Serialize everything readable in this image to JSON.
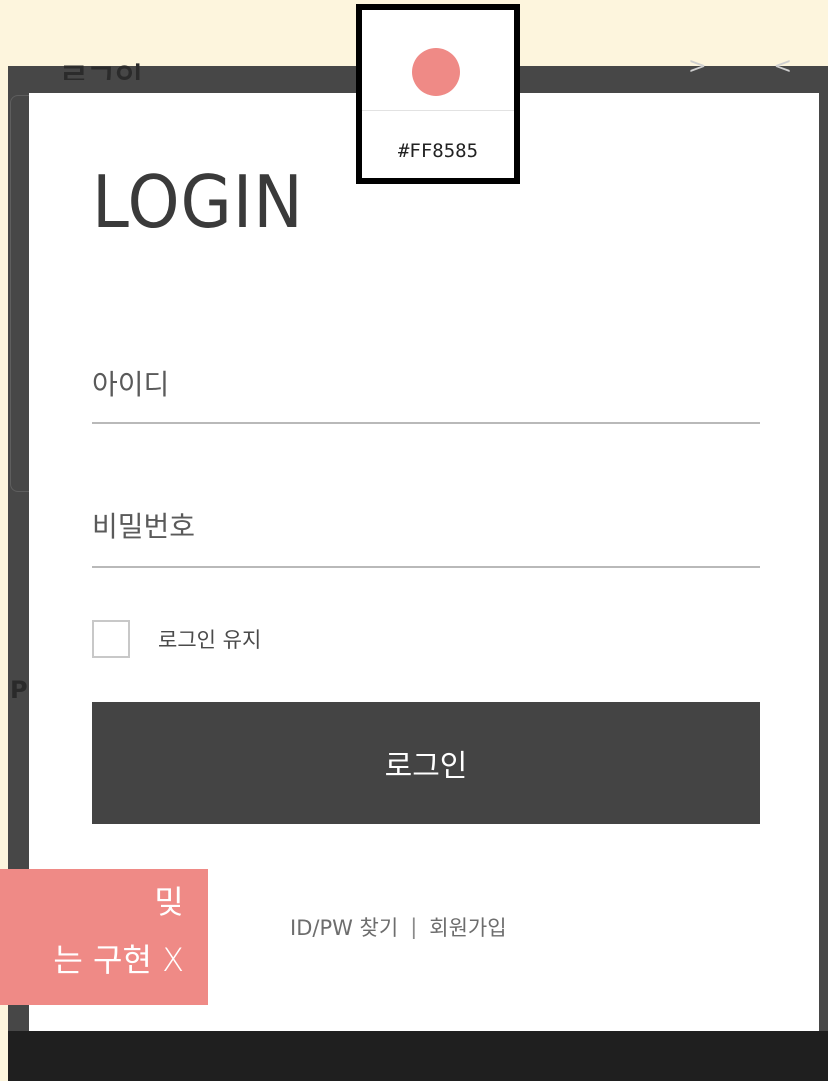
{
  "background": {
    "heading": "로그인",
    "chevrons": "> <",
    "side_letter": "P"
  },
  "modal": {
    "title": "LOGIN",
    "id_placeholder": "아이디",
    "password_placeholder": "비밀번호",
    "keep_login_label": "로그인 유지",
    "login_button": "로그인",
    "find_link": "ID/PW 찾기",
    "separator": "|",
    "signup_link": "회원가입"
  },
  "color_picker": {
    "hex": "#FF8585",
    "swatch_color": "#ef8a86"
  },
  "annotation": {
    "line1": "밎",
    "line2": "는 구현 X",
    "color": "#ef8a86"
  },
  "colors": {
    "button": "#444444",
    "backdrop": "#474747"
  }
}
